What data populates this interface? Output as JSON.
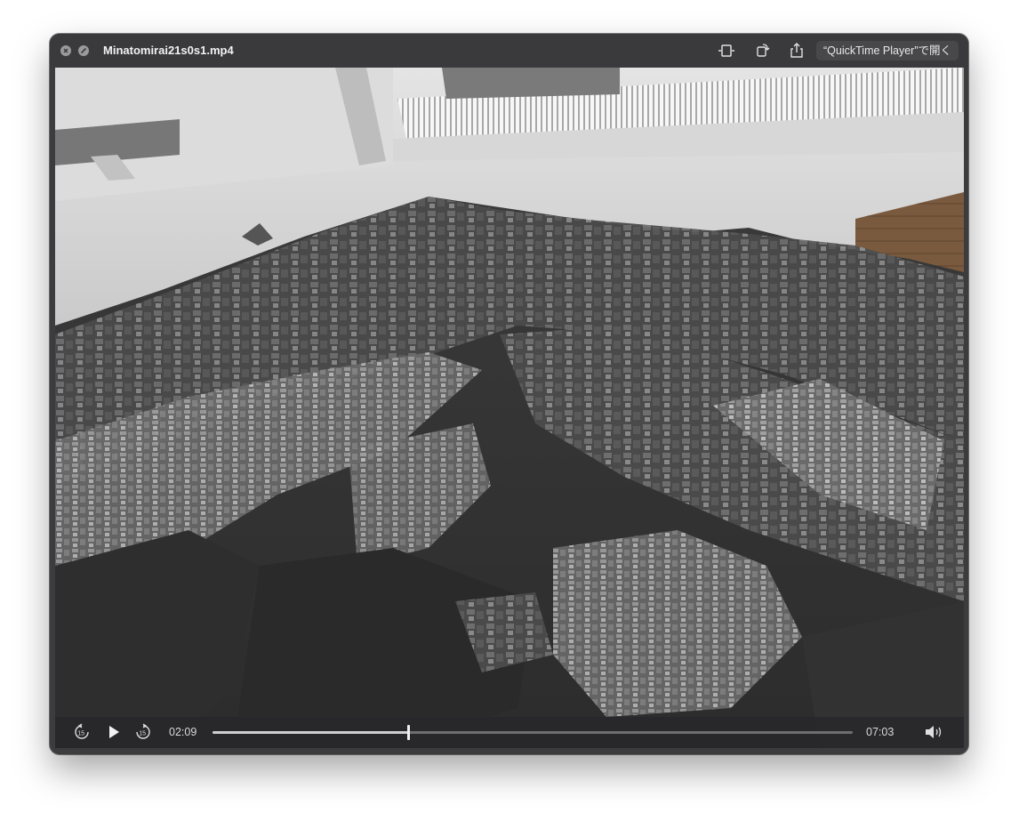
{
  "window": {
    "title": "Minatomirai21s0s1.mp4",
    "open_in_label": "“QuickTime Player”で開く",
    "icons": [
      "close-icon",
      "minimize-icon",
      "trim-icon",
      "rotate-icon",
      "share-icon"
    ]
  },
  "player": {
    "current_time": "02:09",
    "duration": "07:03",
    "progress": 0.305,
    "skip_back_seconds": "15",
    "skip_forward_seconds": "15",
    "icons": [
      "skip-back-15-icon",
      "play-icon",
      "skip-forward-15-icon",
      "volume-icon"
    ]
  },
  "colors": {
    "window_bg": "#3c3c3e",
    "titlebar": "#3a3a3c",
    "controls_bg": "#28282a",
    "text": "#f2f2f2"
  }
}
